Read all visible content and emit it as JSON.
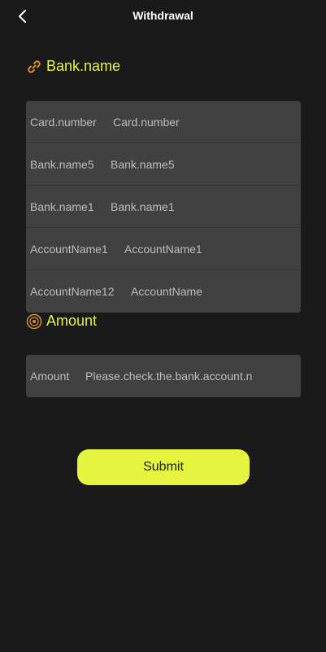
{
  "header": {
    "title": "Withdrawal"
  },
  "bank_section": {
    "title": "Bank.name",
    "rows": [
      {
        "label": "Card.number",
        "placeholder": "Card.number"
      },
      {
        "label": "Bank.name5",
        "placeholder": "Bank.name5"
      },
      {
        "label": "Bank.name1",
        "placeholder": "Bank.name1"
      },
      {
        "label": "AccountName1",
        "placeholder": "AccountName1"
      },
      {
        "label": "AccountName12",
        "placeholder": "AccountName"
      }
    ]
  },
  "amount_section": {
    "title": "Amount",
    "row": {
      "label": "Amount",
      "placeholder": "Please.check.the.bank.account.n"
    }
  },
  "submit_label": "Submit",
  "colors": {
    "accent": "#e4f43f",
    "background": "#1a1a1a",
    "field": "#414141"
  }
}
